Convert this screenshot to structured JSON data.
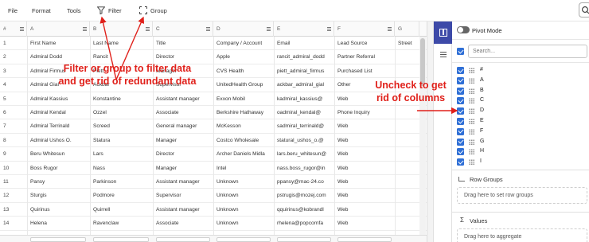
{
  "menubar": {
    "items": [
      "File",
      "Format",
      "Tools"
    ],
    "filter_label": "Filter",
    "group_label": "Group"
  },
  "grid": {
    "columns": [
      "#",
      "A",
      "B",
      "C",
      "D",
      "E",
      "F",
      "G"
    ],
    "header_first": [
      "1",
      "First Name",
      "Last Name",
      "Title",
      "Company / Account",
      "Email",
      "Lead Source",
      "Street"
    ],
    "rows": [
      [
        "2",
        "Admiral Dodd",
        "Rancit",
        "Director",
        "Apple",
        "rancit_admiral_dodd",
        "Partner Referral",
        ""
      ],
      [
        "3",
        "Admiral Firmus",
        "Piett",
        "Manager",
        "CVS Health",
        "piett_admiral_firmus",
        "Purchased List",
        ""
      ],
      [
        "4",
        "Admiral Gial",
        "Ackbar",
        "Supervisor",
        "UnitedHealth Group",
        "ackbar_admiral_gial",
        "Other",
        ""
      ],
      [
        "5",
        "Admiral Kassius",
        "Konstantine",
        "Assistant manager",
        "Exxon Mobil",
        "kadmiral_kassius@",
        "Web",
        ""
      ],
      [
        "6",
        "Admiral Kendal",
        "Ozzel",
        "Associate",
        "Berkshire Hathaway",
        "oadmiral_kendal@",
        "Phone Inquiry",
        ""
      ],
      [
        "7",
        "Admiral Terrinald",
        "Screed",
        "General manager",
        "McKesson",
        "sadmiral_terrinald@",
        "Web",
        ""
      ],
      [
        "8",
        "Admiral Ushos O.",
        "Statura",
        "Manager",
        "Costco Wholesale",
        "statural_ushos_o.@",
        "Web",
        ""
      ],
      [
        "9",
        "Beru Whitesun",
        "Lars",
        "Director",
        "Archer Daniels Midla",
        "lars.beru_whitesun@",
        "Web",
        ""
      ],
      [
        "10",
        "Boss Rugor",
        "Nass",
        "Manager",
        "Intel",
        "nass.boss_rugor@in",
        "Web",
        ""
      ],
      [
        "11",
        "Pansy",
        "Parkinson",
        "Assistant manager",
        "Unknown",
        "ppansy@mac-24.co",
        "Web",
        ""
      ],
      [
        "12",
        "Sturgis",
        "Podmore",
        "Supervisor",
        "Unknown",
        "pstrugis@mozej.com",
        "Web",
        ""
      ],
      [
        "13",
        "Quirinus",
        "Quirrell",
        "Assistant manager",
        "Unknown",
        "qquirinus@kobrandl",
        "Web",
        ""
      ],
      [
        "14",
        "Helena",
        "Ravenclaw",
        "Associate",
        "Unknown",
        "rhelena@popcornfa",
        "Web",
        ""
      ]
    ]
  },
  "panel": {
    "pivot_mode_label": "Pivot Mode",
    "search_placeholder": "Search...",
    "columns": [
      "#",
      "A",
      "B",
      "C",
      "D",
      "E",
      "F",
      "G",
      "H",
      "I"
    ],
    "row_groups_label": "Row Groups",
    "row_groups_drop": "Drag here to set row groups",
    "values_sigma": "Σ",
    "values_label": "Values",
    "values_drop": "Drag here to aggregate"
  },
  "annotations": {
    "filter_text": [
      "Filter or group to filter data",
      "and get rid of redundant data"
    ],
    "uncheck_text": [
      "Uncheck to get",
      "rid of columns"
    ],
    "color": "#e0201a"
  },
  "colors": {
    "accent": "#3d4aa8",
    "checkbox": "#2f6fd6"
  }
}
